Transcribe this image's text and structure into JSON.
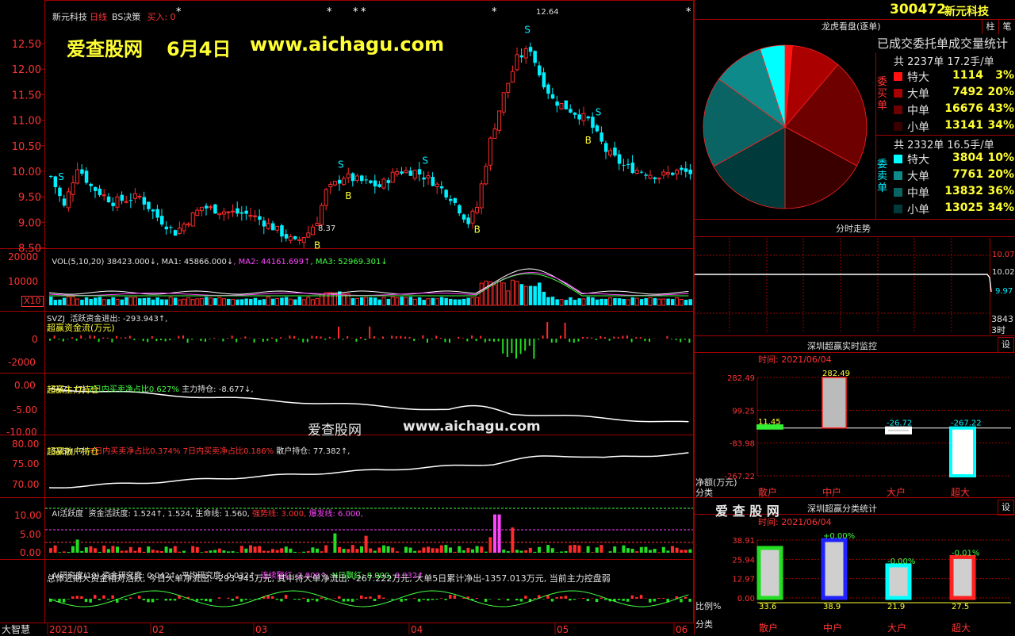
{
  "header": {
    "stock_name": "新元科技",
    "period": "日线",
    "strategy": "BS决策",
    "buy_label": "买入: 0",
    "high_label": "12.64",
    "low_label": "8.37",
    "watermark_site": "爱查股网",
    "watermark_date": "6月4日",
    "watermark_url": "www.aichagu.com"
  },
  "price_axis": [
    "12.50",
    "12.00",
    "11.50",
    "11.00",
    "10.50",
    "10.00",
    "9.50",
    "9.00",
    "8.50"
  ],
  "vol_panel": {
    "legend_name": "VOL(5,10,20)",
    "vol": "38423.000↓",
    "ma1": ", MA1: 45866.000↓",
    "ma2": ", MA2: 44161.699↑",
    "ma3": ", MA3: 52969.301↓",
    "axis": [
      "20000",
      "10000"
    ],
    "unit": "X10"
  },
  "svzj_panel": {
    "legend": "SVZJ  活跃资金进出: -293.943↑,",
    "sub": "超赢资金流(万元)",
    "axis": [
      "0",
      "-2000"
    ]
  },
  "svzl_panel": {
    "legend_a": "SVZL (7) ",
    "legend_b": "7日内买卖净占比0.627%",
    "legend_c": " 主力持仓: -8.677↓,",
    "sub": "超赢主力持仓",
    "axis": [
      "0.00",
      "-5.00",
      "-10.00"
    ]
  },
  "svsh_panel": {
    "legend_a": "SVSH (7) ",
    "legend_b": "7日内买卖净占比0.374% 7日内买卖净占比0.186%",
    "legend_c": " 散户持仓: 77.382↑,",
    "sub": "超赢散户持仓",
    "axis": [
      "80.00",
      "75.00",
      "70.00"
    ]
  },
  "ai_panel": {
    "legend_a": "AI活跃度  资金活跃度: 1.524↑, 1.524, 生命线: 1.560,",
    "legend_b": " 强势线: 3.000, ",
    "legend_c": "爆发线: 6.000,",
    "axis": [
      "10.00",
      "5.00",
      "0.00"
    ]
  },
  "research_panel": {
    "legend_a": "AI研究度(10) 资金研究度: 0.042↑, 平均研究度: 0.032↑, ",
    "legend_b": "连续飘红: 2.000↑, ",
    "legend_c": "N日飘红: 8.000, ",
    "legend_d": "0.032↑",
    "summary": "总体近期大资金相对活跃, 今日大单净流出: -293.945万元, 其中特大单净流出: -267.222万元, 大单5日累计净出-1357.013万元, 当前主力控盘弱"
  },
  "date_axis": [
    "2021/01",
    "02",
    "03",
    "04",
    "05",
    "06"
  ],
  "bottom_left_label": "大智慧",
  "right_panel": {
    "code": "300472",
    "name": "新元科技",
    "mode_title": "龙虎看盘(逐单)",
    "btn_zhu": "柱",
    "btn_bi": "笔",
    "stats_title": "已成交委托单成交量统计",
    "buy_total": "共 2237单 17.2手/单",
    "buy_side_label": "委买单",
    "buy_rows": [
      {
        "label": "特大",
        "value": "1114",
        "pct": "3%",
        "color": "#ff1111"
      },
      {
        "label": "大单",
        "value": "7492",
        "pct": "20%",
        "color": "#aa0000"
      },
      {
        "label": "中单",
        "value": "16676",
        "pct": "43%",
        "color": "#6e0000"
      },
      {
        "label": "小单",
        "value": "13141",
        "pct": "34%",
        "color": "#3a0000"
      }
    ],
    "sell_total": "共 2332单 16.5手/单",
    "sell_side_label": "委卖单",
    "sell_rows": [
      {
        "label": "特大",
        "value": "3804",
        "pct": "10%",
        "color": "#00ffff"
      },
      {
        "label": "大单",
        "value": "7761",
        "pct": "20%",
        "color": "#0e8a8a"
      },
      {
        "label": "中单",
        "value": "13832",
        "pct": "36%",
        "color": "#0a6464"
      },
      {
        "label": "小单",
        "value": "13025",
        "pct": "34%",
        "color": "#003a3a"
      }
    ],
    "intraday_title": "分时走势",
    "intraday_axis": [
      "10.07",
      "10.02",
      "9.97"
    ],
    "intraday_footer": "38433时",
    "monitor_title": "深圳超赢实时监控",
    "settings_btn": "设",
    "monitor_date": "时间: 2021/06/04",
    "monitor_axis": [
      "282.49",
      "99.25",
      "-83.98",
      "-267.22"
    ],
    "monitor_axis_unit": "净额(万元)",
    "monitor_axis_cat": "分类",
    "classify_title": "深圳超赢分类统计",
    "classify_date": "时间: 2021/06/04",
    "classify_axis": [
      "38.91",
      "25.94",
      "12.97",
      "0.00"
    ],
    "classify_axis_unit": "比例%",
    "classify_axis_cat": "分类",
    "watermark2": "爱 查 股 网"
  },
  "monitor_chart": {
    "type": "bar",
    "categories": [
      "散户",
      "中户",
      "大户",
      "超大"
    ],
    "values": [
      11.45,
      282.49,
      -26.72,
      -267.22
    ],
    "labels": [
      "11.45",
      "282.49",
      "-26.72",
      "-267.22"
    ],
    "ylim": [
      -267.22,
      282.49
    ]
  },
  "classify_chart": {
    "type": "bar",
    "categories": [
      "散户",
      "中户",
      "大户",
      "超大"
    ],
    "values": [
      33.6,
      38.9,
      21.9,
      27.5
    ],
    "labels": [
      "33.6",
      "38.9",
      "21.9",
      "27.5"
    ],
    "top_labels": [
      "",
      "+0.00%",
      "-0.00%",
      "-0.01%"
    ],
    "ylim": [
      0,
      38.91
    ]
  },
  "pie_chart": {
    "type": "pie",
    "slices": [
      {
        "name": "特大买",
        "value": 1114
      },
      {
        "name": "大单买",
        "value": 7492
      },
      {
        "name": "中单买",
        "value": 16676
      },
      {
        "name": "小单买",
        "value": 13141
      },
      {
        "name": "小单卖",
        "value": 13025
      },
      {
        "name": "中单卖",
        "value": 13832
      },
      {
        "name": "大单卖",
        "value": 7761
      },
      {
        "name": "特大卖",
        "value": 3804
      }
    ]
  },
  "colors": {
    "up": "#ff2a2a",
    "down": "#00f0ff",
    "grid": "#a00000",
    "axis_text": "#ff3333",
    "accent_yellow": "#ffff33"
  }
}
